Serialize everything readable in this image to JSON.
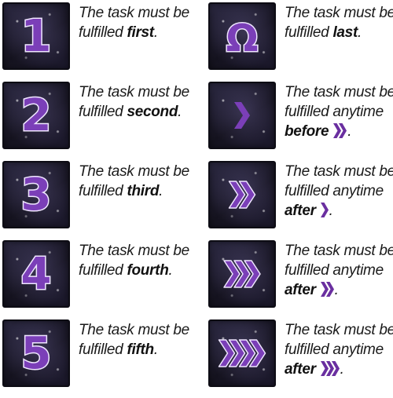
{
  "colors": {
    "accent": "#6a2fa0",
    "tile_dark": "#1a1828",
    "text": "#1a1a1a"
  },
  "items": [
    {
      "icon": "number-1-icon",
      "symbol": "1",
      "line1": "The task must be",
      "line2": "fulfilled",
      "keyword": "first",
      "punct": "."
    },
    {
      "icon": "omega-icon",
      "symbol": "Ω",
      "line1": "The task must be",
      "line2": "fulfilled",
      "keyword": "last",
      "punct": "."
    },
    {
      "icon": "number-2-icon",
      "symbol": "2",
      "line1": "The task must be",
      "line2": "fulfilled",
      "keyword": "second",
      "punct": "."
    },
    {
      "icon": "chevron-1-icon",
      "chevrons": 1,
      "line1": "The task must be",
      "line2": "fulfilled anytime",
      "keyword": "before",
      "ref_chevrons": 2,
      "punct": "."
    },
    {
      "icon": "number-3-icon",
      "symbol": "3",
      "line1": "The task must be",
      "line2": "fulfilled",
      "keyword": "third",
      "punct": "."
    },
    {
      "icon": "chevron-2-icon",
      "chevrons": 2,
      "line1": "The task must be",
      "line2": "fulfilled anytime",
      "keyword": "after",
      "ref_chevrons": 1,
      "punct": "."
    },
    {
      "icon": "number-4-icon",
      "symbol": "4",
      "line1": "The task must be",
      "line2": "fulfilled",
      "keyword": "fourth",
      "punct": "."
    },
    {
      "icon": "chevron-3-icon",
      "chevrons": 3,
      "line1": "The task must be",
      "line2": "fulfilled anytime",
      "keyword": "after",
      "ref_chevrons": 2,
      "punct": "."
    },
    {
      "icon": "number-5-icon",
      "symbol": "5",
      "line1": "The task must be",
      "line2": "fulfilled",
      "keyword": "fifth",
      "punct": "."
    },
    {
      "icon": "chevron-4-icon",
      "chevrons": 4,
      "line1": "The task must be",
      "line2": "fulfilled anytime",
      "keyword": "after",
      "ref_chevrons": 3,
      "punct": "."
    }
  ]
}
